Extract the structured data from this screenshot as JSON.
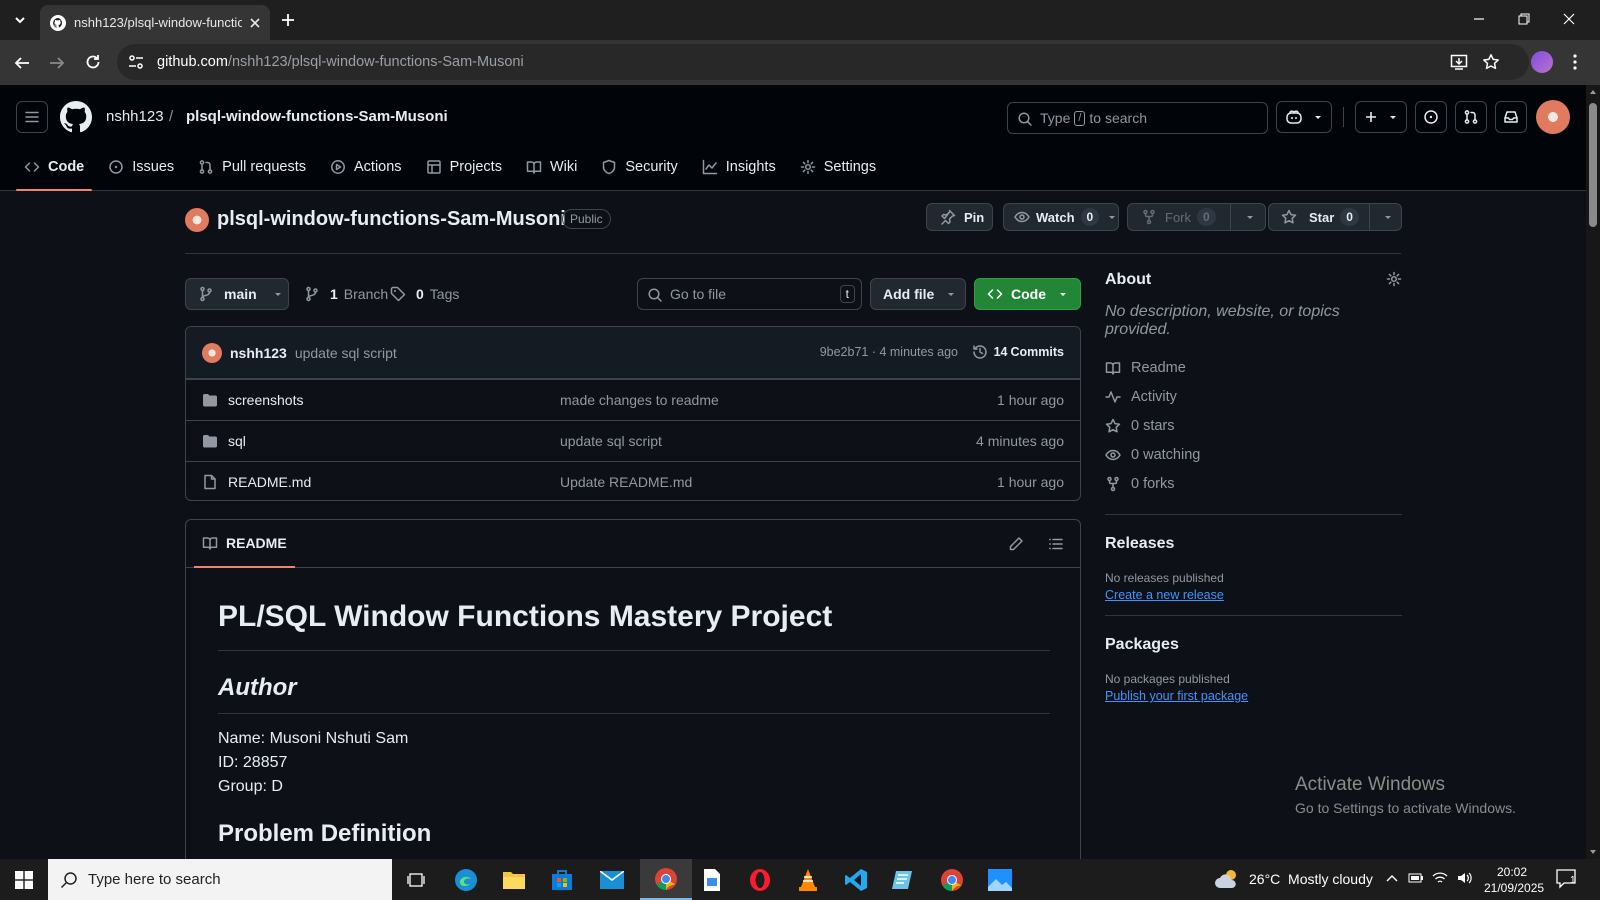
{
  "browser": {
    "tab_title": "nshh123/plsql-window-functio",
    "url_host": "github.com",
    "url_path": "/nshh123/plsql-window-functions-Sam-Musoni"
  },
  "header": {
    "owner": "nshh123",
    "slash": "/",
    "repo": "plsql-window-functions-Sam-Musoni",
    "search_prefix": "Type",
    "search_key": "/",
    "search_suffix": "to search"
  },
  "repo_nav": [
    {
      "label": "Code",
      "icon": "code-icon",
      "selected": true
    },
    {
      "label": "Issues",
      "icon": "issue-icon"
    },
    {
      "label": "Pull requests",
      "icon": "pull-request-icon"
    },
    {
      "label": "Actions",
      "icon": "play-icon"
    },
    {
      "label": "Projects",
      "icon": "table-icon"
    },
    {
      "label": "Wiki",
      "icon": "book-icon"
    },
    {
      "label": "Security",
      "icon": "shield-icon"
    },
    {
      "label": "Insights",
      "icon": "graph-icon"
    },
    {
      "label": "Settings",
      "icon": "gear-icon"
    }
  ],
  "repo_title": {
    "name": "plsql-window-functions-Sam-Musoni",
    "visibility": "Public",
    "pin": "Pin",
    "watch": "Watch",
    "watch_count": "0",
    "fork": "Fork",
    "fork_count": "0",
    "star": "Star",
    "star_count": "0"
  },
  "toolbar": {
    "branch": "main",
    "branches_count": "1",
    "branches_label": "Branch",
    "tags_count": "0",
    "tags_label": "Tags",
    "go_to_file": "Go to file",
    "go_to_file_key": "t",
    "add_file": "Add file",
    "code": "Code"
  },
  "latest_commit": {
    "author": "nshh123",
    "message": "update sql script",
    "meta": "9be2b71 · 4 minutes ago",
    "commits_count": "14",
    "commits_label": "Commits"
  },
  "files": [
    {
      "name": "screenshots",
      "type": "folder",
      "message": "made changes to readme",
      "time": "1 hour ago"
    },
    {
      "name": "sql",
      "type": "folder",
      "message": "update sql script",
      "time": "4 minutes ago"
    },
    {
      "name": "README.md",
      "type": "file",
      "message": "Update README.md",
      "time": "1 hour ago"
    }
  ],
  "readme": {
    "tab_label": "README",
    "h1": "PL/SQL Window Functions Mastery Project",
    "h2_author": "Author",
    "name_line": "Name: Musoni Nshuti Sam",
    "id_line": "ID: 28857",
    "group_line": "Group: D",
    "h2_problem": "Problem Definition"
  },
  "about": {
    "title": "About",
    "description": "No description, website, or topics provided.",
    "stats": [
      {
        "label": "Readme",
        "icon": "book-icon"
      },
      {
        "label": "Activity",
        "icon": "pulse-icon"
      },
      {
        "label": "0 stars",
        "icon": "star-icon"
      },
      {
        "label": "0 watching",
        "icon": "eye-icon"
      },
      {
        "label": "0 forks",
        "icon": "fork-icon"
      }
    ],
    "releases_title": "Releases",
    "releases_text": "No releases published",
    "releases_link": "Create a new release",
    "packages_title": "Packages",
    "packages_text": "No packages published",
    "packages_link": "Publish your first package"
  },
  "watermark": {
    "line1": "Activate Windows",
    "line2": "Go to Settings to activate Windows."
  },
  "taskbar": {
    "search_placeholder": "Type here to search",
    "weather": "26°C  Mostly cloudy",
    "time": "20:02",
    "date": "21/09/2025",
    "notifications": "1"
  },
  "colors": {
    "accent_green": "#238636",
    "link_blue": "#4493f8",
    "selected_underline": "#f78166"
  }
}
